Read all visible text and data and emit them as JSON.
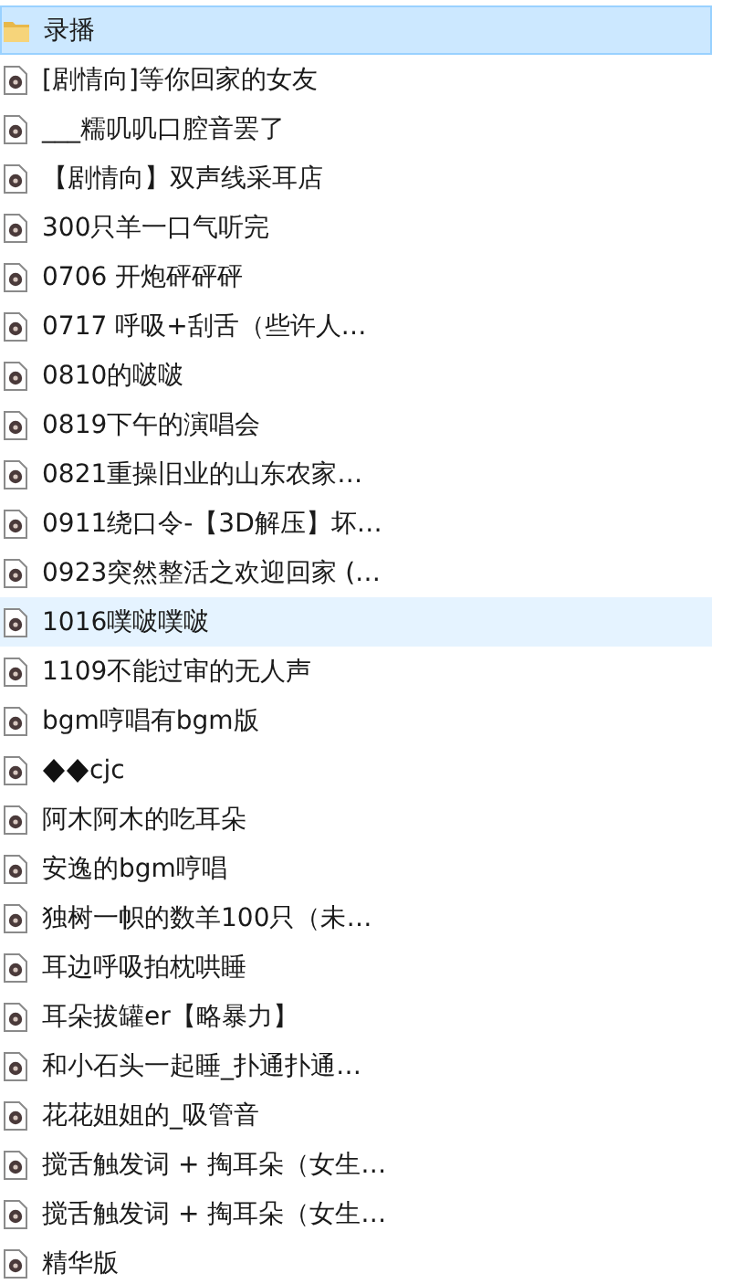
{
  "files": [
    {
      "kind": "folder",
      "name": "录播",
      "selected": true,
      "hovered": false
    },
    {
      "kind": "audio",
      "name": "[剧情向]等你回家的女友",
      "selected": false,
      "hovered": false
    },
    {
      "kind": "audio",
      "name": "___糯叽叽口腔音罢了",
      "selected": false,
      "hovered": false
    },
    {
      "kind": "audio",
      "name": "【剧情向】双声线采耳店",
      "selected": false,
      "hovered": false
    },
    {
      "kind": "audio",
      "name": "300只羊一口气听完",
      "selected": false,
      "hovered": false
    },
    {
      "kind": "audio",
      "name": "0706 开炮砰砰砰",
      "selected": false,
      "hovered": false
    },
    {
      "kind": "audio",
      "name": "0717 呼吸+刮舌（些许人…",
      "selected": false,
      "hovered": false
    },
    {
      "kind": "audio",
      "name": "0810的啵啵",
      "selected": false,
      "hovered": false
    },
    {
      "kind": "audio",
      "name": "0819下午的演唱会",
      "selected": false,
      "hovered": false
    },
    {
      "kind": "audio",
      "name": "0821重操旧业的山东农家…",
      "selected": false,
      "hovered": false
    },
    {
      "kind": "audio",
      "name": "0911绕口令-【3D解压】坏…",
      "selected": false,
      "hovered": false
    },
    {
      "kind": "audio",
      "name": "0923突然整活之欢迎回家 (…",
      "selected": false,
      "hovered": false
    },
    {
      "kind": "audio",
      "name": "1016噗啵噗啵",
      "selected": false,
      "hovered": true
    },
    {
      "kind": "audio",
      "name": "1109不能过审的无人声",
      "selected": false,
      "hovered": false
    },
    {
      "kind": "audio",
      "name": "bgm哼唱有bgm版",
      "selected": false,
      "hovered": false
    },
    {
      "kind": "audio",
      "name": "cjc",
      "garbled_prefix": true,
      "selected": false,
      "hovered": false
    },
    {
      "kind": "audio",
      "name": "阿木阿木的吃耳朵",
      "selected": false,
      "hovered": false
    },
    {
      "kind": "audio",
      "name": "安逸的bgm哼唱",
      "selected": false,
      "hovered": false
    },
    {
      "kind": "audio",
      "name": "独树一帜的数羊100只（未…",
      "selected": false,
      "hovered": false
    },
    {
      "kind": "audio",
      "name": "耳边呼吸拍枕哄睡",
      "selected": false,
      "hovered": false
    },
    {
      "kind": "audio",
      "name": "耳朵拔罐er【略暴力】",
      "selected": false,
      "hovered": false
    },
    {
      "kind": "audio",
      "name": "和小石头一起睡_扑通扑通…",
      "selected": false,
      "hovered": false
    },
    {
      "kind": "audio",
      "name": "花花姐姐的_吸管音",
      "selected": false,
      "hovered": false
    },
    {
      "kind": "audio",
      "name": "搅舌触发词 + 掏耳朵（女生…",
      "selected": false,
      "hovered": false
    },
    {
      "kind": "audio",
      "name": "搅舌触发词 + 掏耳朵（女生…",
      "selected": false,
      "hovered": false
    },
    {
      "kind": "audio",
      "name": "精华版",
      "selected": false,
      "hovered": false
    }
  ]
}
